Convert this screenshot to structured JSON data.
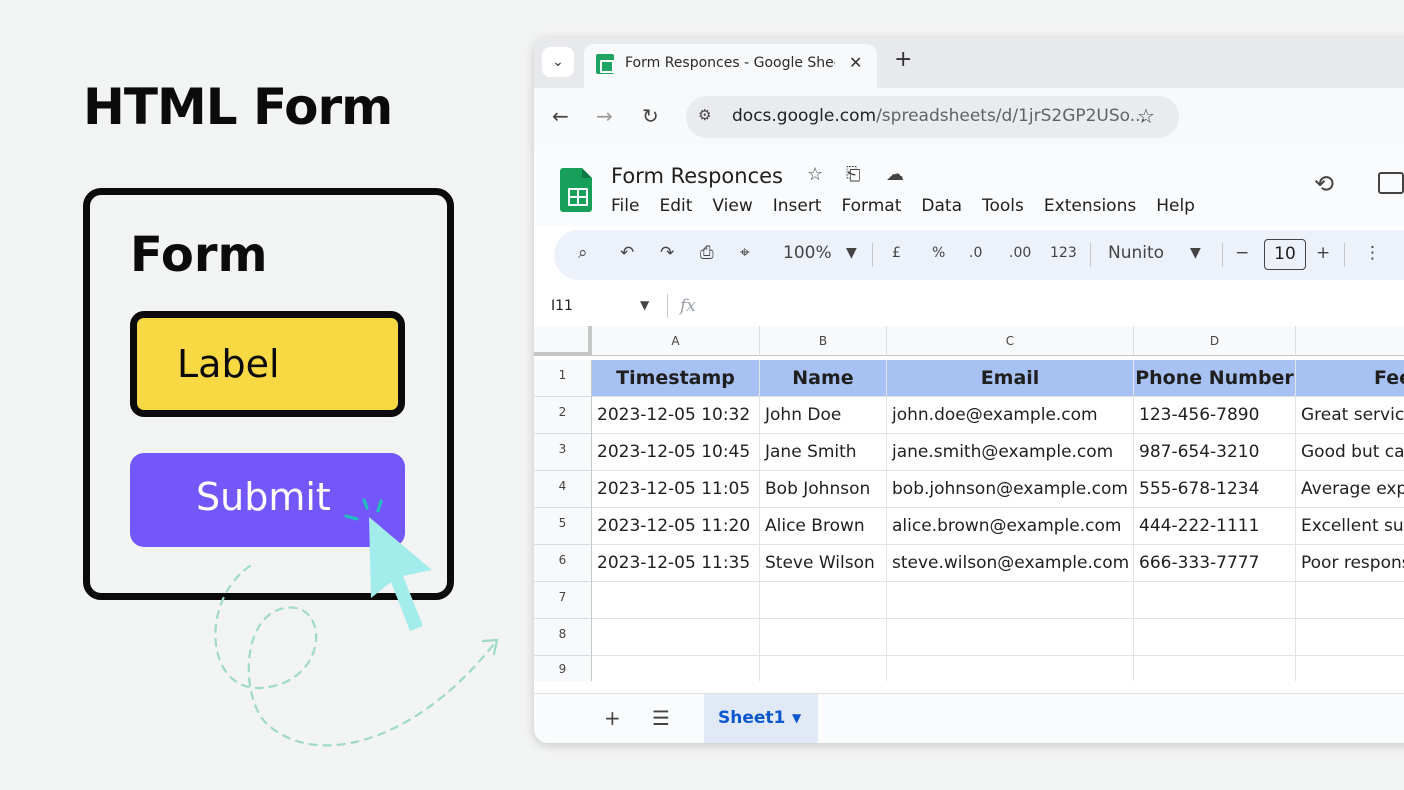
{
  "hero": {
    "title": "HTML Form"
  },
  "form_card": {
    "heading": "Form",
    "label_text": "Label",
    "submit_label": "Submit"
  },
  "browser": {
    "tab_title": "Form Responces - Google Sheets",
    "url_domain": "docs.google.com",
    "url_path": "/spreadsheets/d/1jrS2GP2USo...",
    "icons": [
      "tab-menu-chevron",
      "close-icon",
      "new-tab-plus",
      "back-arrow",
      "forward-arrow",
      "reload-icon",
      "site-settings-icon",
      "bookmark-star"
    ]
  },
  "sheets": {
    "doc_title": "Form Responces",
    "menu": [
      "File",
      "Edit",
      "View",
      "Insert",
      "Format",
      "Data",
      "Tools",
      "Extensions",
      "Help"
    ],
    "toolbar": {
      "zoom": "100%",
      "currency": "£",
      "percent": "%",
      "dec_decrease": ".0",
      "dec_increase": ".00",
      "number_format": "123",
      "font": "Nunito",
      "font_size": "10"
    },
    "name_box": "I11",
    "fx": "fx",
    "columns": [
      "A",
      "B",
      "C",
      "D",
      ""
    ],
    "rows": [
      "1",
      "2",
      "3",
      "4",
      "5",
      "6",
      "7",
      "8",
      "9"
    ],
    "header": [
      "Timestamp",
      "Name",
      "Email",
      "Phone Number",
      "Fee"
    ],
    "data": [
      [
        "2023-12-05 10:32",
        "John Doe",
        "john.doe@example.com",
        "123-456-7890",
        "Great service"
      ],
      [
        "2023-12-05 10:45",
        "Jane Smith",
        "jane.smith@example.com",
        "987-654-3210",
        "Good but can"
      ],
      [
        "2023-12-05 11:05",
        "Bob Johnson",
        "bob.johnson@example.com",
        "555-678-1234",
        "Average exp"
      ],
      [
        "2023-12-05 11:20",
        "Alice Brown",
        "alice.brown@example.com",
        "444-222-1111",
        "Excellent sup"
      ],
      [
        "2023-12-05 11:35",
        "Steve Wilson",
        "steve.wilson@example.com",
        "666-333-7777",
        "Poor respons"
      ]
    ],
    "sheet_tab": "Sheet1"
  },
  "colors": {
    "header_fill": "#a7c1f2",
    "label_yellow": "#f9d943",
    "submit_purple": "#7357fa",
    "cursor_cyan": "#a3ecec",
    "sheets_green": "#18a05a"
  }
}
